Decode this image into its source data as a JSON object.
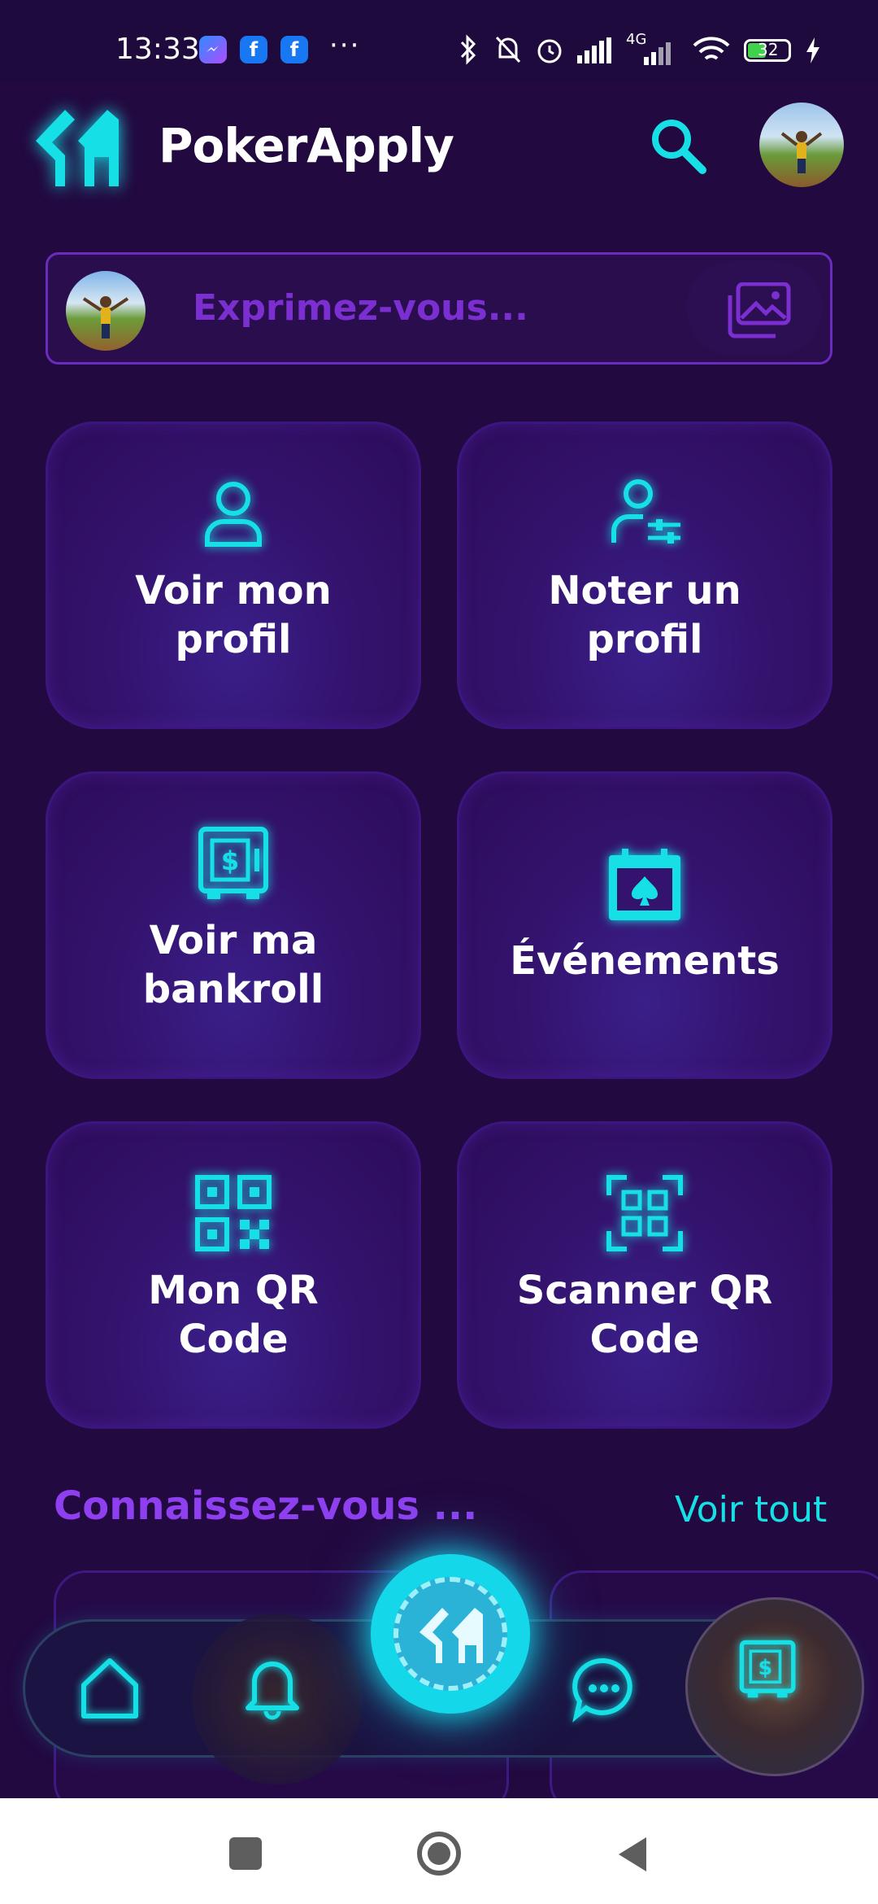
{
  "status_bar": {
    "time": "13:33",
    "network": "4G",
    "battery": "32",
    "more": "···"
  },
  "header": {
    "app_name": "PokerApply",
    "logo_icon": "pokerapply-logo-icon",
    "search_icon": "search-icon"
  },
  "composer": {
    "placeholder": "Exprimez-vous...",
    "image_icon": "image-icon"
  },
  "tiles": [
    {
      "label_line1": "Voir mon",
      "label_line2": "profil",
      "icon": "user-icon"
    },
    {
      "label_line1": "Noter un",
      "label_line2": "profil",
      "icon": "user-settings-icon"
    },
    {
      "label_line1": "Voir ma",
      "label_line2": "bankroll",
      "icon": "safe-icon"
    },
    {
      "label_line1": "Événements",
      "label_line2": "",
      "icon": "calendar-spade-icon"
    },
    {
      "label_line1": "Mon QR",
      "label_line2": "Code",
      "icon": "qr-code-icon"
    },
    {
      "label_line1": "Scanner QR",
      "label_line2": "Code",
      "icon": "qr-scan-icon"
    }
  ],
  "section": {
    "title": "Connaissez-vous ...",
    "see_all": "Voir tout"
  },
  "bottom_nav": {
    "items": [
      "home-icon",
      "bell-icon",
      "poker-chip-icon",
      "chat-icon",
      "bankroll-icon"
    ]
  },
  "colors": {
    "background": "#22093f",
    "accent_cyan": "#16e0e6",
    "accent_purple": "#8e3ff0"
  }
}
